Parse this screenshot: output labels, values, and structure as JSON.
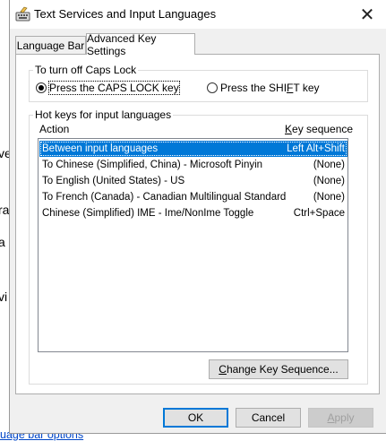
{
  "background": {
    "fragments": [
      "ve",
      "ra",
      "a",
      "vi"
    ],
    "link": "uage bar options"
  },
  "dialog": {
    "title": "Text Services and Input Languages",
    "tabs": [
      {
        "label": "Language Bar",
        "active": false
      },
      {
        "label": "Advanced Key Settings",
        "active": true
      }
    ],
    "caps_lock": {
      "group_label": "To turn off Caps Lock",
      "option_caps": "Press the CAPS LOCK key",
      "option_shift_pre": "Press the SHI",
      "option_shift_ak": "F",
      "option_shift_post": "T key",
      "selected": "caps"
    },
    "hotkeys": {
      "group_label": "Hot keys for input languages",
      "col_action": "Action",
      "col_key_ak": "K",
      "col_key_rest": "ey sequence",
      "rows": [
        {
          "action": "Between input languages",
          "key": "Left Alt+Shift",
          "selected": true
        },
        {
          "action": "To Chinese (Simplified, China) - Microsoft Pinyin",
          "key": "(None)",
          "selected": false
        },
        {
          "action": "To English (United States) - US",
          "key": "(None)",
          "selected": false
        },
        {
          "action": "To French (Canada) - Canadian Multilingual Standard",
          "key": "(None)",
          "selected": false
        },
        {
          "action": "Chinese (Simplified) IME - Ime/NonIme Toggle",
          "key": "Ctrl+Space",
          "selected": false
        }
      ],
      "change_button_ak": "C",
      "change_button_rest": "hange Key Sequence..."
    },
    "buttons": {
      "ok": "OK",
      "cancel": "Cancel",
      "apply_ak": "A",
      "apply_rest": "pply"
    }
  },
  "colors": {
    "selection": "#0078d7",
    "link": "#0046c8"
  }
}
